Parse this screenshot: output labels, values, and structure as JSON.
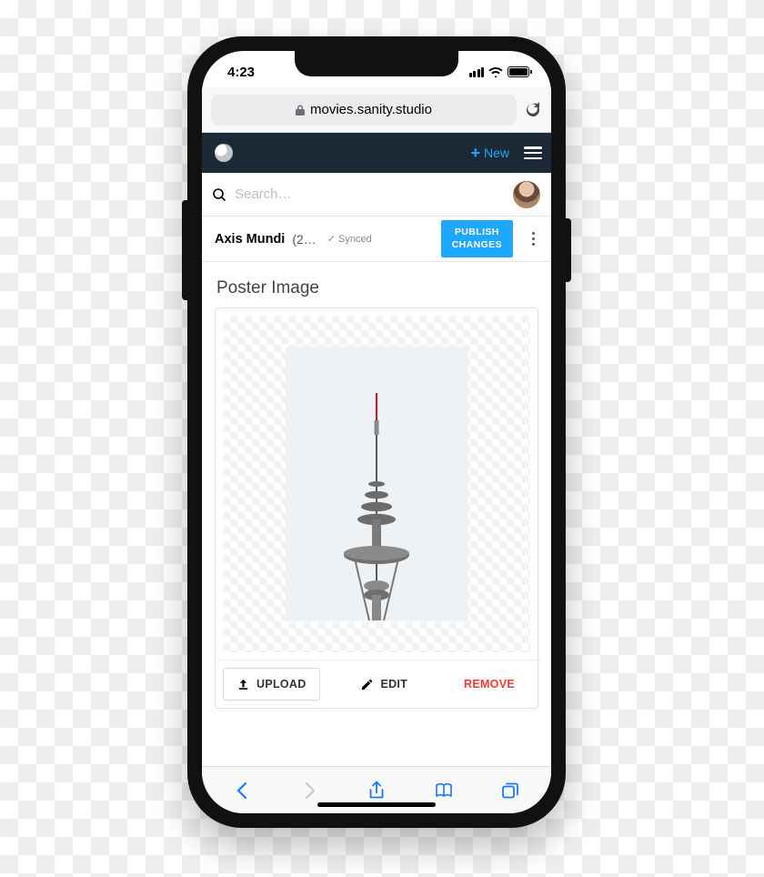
{
  "status": {
    "time": "4:23"
  },
  "browser": {
    "url": "movies.sanity.studio"
  },
  "app_header": {
    "new_label": "New"
  },
  "search": {
    "placeholder": "Search…"
  },
  "doc": {
    "title": "Axis Mundi",
    "subtitle": "(2…",
    "sync_status": "Synced",
    "publish_label_line1": "PUBLISH",
    "publish_label_line2": "CHANGES"
  },
  "image_field": {
    "label": "Poster Image",
    "upload_label": "UPLOAD",
    "edit_label": "EDIT",
    "remove_label": "REMOVE"
  }
}
